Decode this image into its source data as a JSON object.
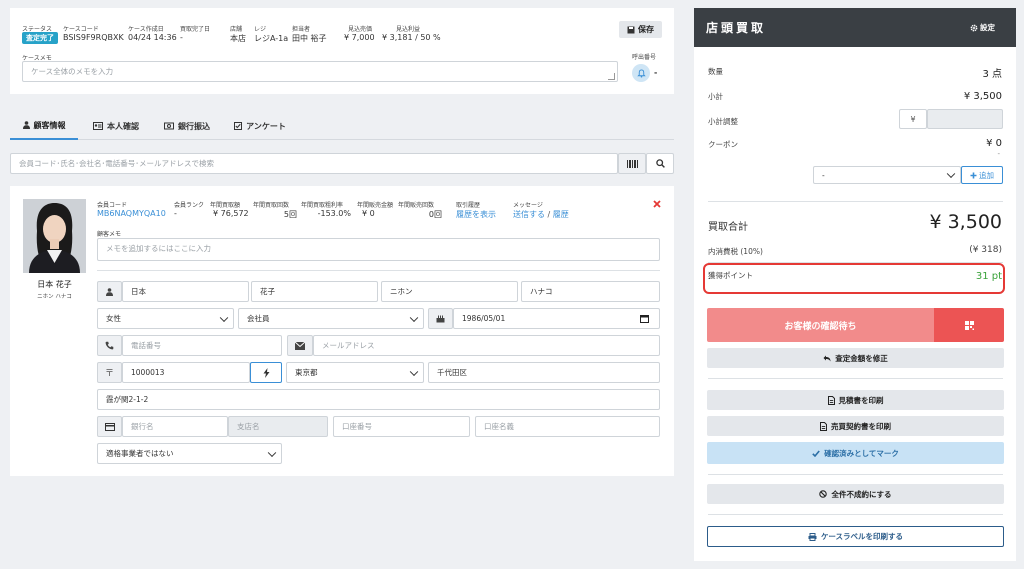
{
  "case_header": {
    "status_label": "ステータス",
    "status_value": "査定完了",
    "case_code_label": "ケースコード",
    "case_code_value": "BSIS9F9RQBXK",
    "created_label": "ケース作成日",
    "created_value": "04/24 14:36",
    "purchase_done_label": "買取完了日",
    "purchase_done_value": "-",
    "store_label": "店舗",
    "store_value": "本店",
    "register_label": "レジ",
    "register_value": "レジA-1a",
    "staff_label": "担当者",
    "staff_value": "田中 裕子",
    "est_sales_label": "見込売価",
    "est_sales_value": "¥ 7,000",
    "est_profit_label": "見込利益",
    "est_profit_value": "¥ 3,181 / 50 %",
    "save_label": "保存",
    "memo_label": "ケースメモ",
    "memo_placeholder": "ケース全体のメモを入力",
    "call_number_label": "呼出番号",
    "call_number_value": "-"
  },
  "tabs": [
    {
      "label": "顧客情報",
      "active": true
    },
    {
      "label": "本人確認",
      "active": false
    },
    {
      "label": "銀行振込",
      "active": false
    },
    {
      "label": "アンケート",
      "active": false
    }
  ],
  "search": {
    "placeholder": "会員コード･氏名･会社名･電話番号･メールアドレスで検索"
  },
  "customer": {
    "name": "日本 花子",
    "name_kana": "ニホン ハナコ",
    "member_code_label": "会員コード",
    "member_code_value": "MB6NAQMYQA10",
    "rank_label": "会員ランク",
    "rank_value": "-",
    "annual_purchase_amount_label": "年間買取額",
    "annual_purchase_amount_value": "¥ 76,572",
    "annual_purchase_count_label": "年間買取回数",
    "annual_purchase_count_value": "5回",
    "annual_gross_margin_label": "年間買取粗利率",
    "annual_gross_margin_value": "-153.0%",
    "annual_sales_amount_label": "年間販売金額",
    "annual_sales_amount_value": "¥ 0",
    "annual_sales_count_label": "年間販売回数",
    "annual_sales_count_value": "0回",
    "history_label": "取引履歴",
    "history_link": "履歴を表示",
    "message_label": "メッセージ",
    "message_send_link": "送信する",
    "message_sep": "/",
    "message_history_link": "履歴",
    "memo_label": "顧客メモ",
    "memo_placeholder": "メモを追加するにはここに入力",
    "last_name": "日本",
    "first_name": "花子",
    "last_name_kana": "ニホン",
    "first_name_kana": "ハナコ",
    "gender": "女性",
    "occupation": "会社員",
    "birthday": "1986/05/01",
    "phone_placeholder": "電話番号",
    "email_placeholder": "メールアドレス",
    "postal_code": "1000013",
    "prefecture": "東京都",
    "city": "千代田区",
    "address": "霞が関2-1-2",
    "bank_name_placeholder": "銀行名",
    "branch_name_placeholder": "支店名",
    "account_number_placeholder": "口座番号",
    "account_holder_placeholder": "口座名義",
    "dealer_status": "適格事業者ではない"
  },
  "right_panel": {
    "title": "店頭買取",
    "settings_label": "設定",
    "quantity_label": "数量",
    "quantity_value": "3 点",
    "subtotal_label": "小計",
    "subtotal_value": "¥ 3,500",
    "subtotal_adjust_label": "小計調整",
    "yen_symbol": "¥",
    "coupon_label": "クーポン",
    "coupon_value": "¥ 0",
    "coupon_sub": "-",
    "coupon_select": "-",
    "add_label": "追加",
    "total_label": "買取合計",
    "total_value": "¥ 3,500",
    "tax_label": "内消費税 (10%)",
    "tax_value": "(¥ 318)",
    "points_label": "獲得ポイント",
    "points_value": "31 pt",
    "confirm_wait_label": "お客様の確認待ち",
    "fix_amount_label": "査定金額を修正",
    "print_estimate_label": "見積書を印刷",
    "print_contract_label": "売買契約書を印刷",
    "mark_confirmed_label": "確認済みとしてマーク",
    "all_reject_label": "全件不成約にする",
    "print_label_label": "ケースラベルを印刷する"
  },
  "colors": {
    "accent_blue": "#3a8fd6",
    "status_badge": "#27a2c8",
    "confirm_btn": "#f28b8b",
    "confirm_btn_dark": "#ec5454",
    "mark_btn": "#c8e2f5",
    "points_green": "#3aa23a",
    "highlight_red": "#e53935",
    "panel_header": "#3a3f44"
  }
}
